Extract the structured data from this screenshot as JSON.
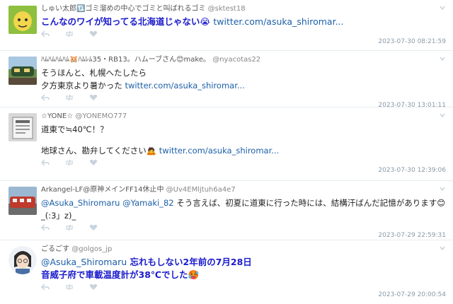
{
  "tweets": [
    {
      "name": "しゅい太郎🔃ゴミ溜めの中心でゴミと叫ばれるゴミ",
      "handle": "@sktest18",
      "lines": [
        "こんなのワイが知ってる北海道じゃない😭"
      ],
      "link": "twitter.com/asuka_shiromar...",
      "date": "2023-07-30 08:21:59"
    },
    {
      "name": "ﾊﾑﾊﾑﾊﾑﾊﾑ🐹ﾊﾑﾚﾑ35・RB13。ハムーブさん😊make。",
      "handle": "@nyacotas22",
      "lines": [
        "そうほんと、札幌へたしたら",
        "夕方東京より暑かった"
      ],
      "link": "twitter.com/asuka_shiromar...",
      "date": "2023-07-30 13:01:11"
    },
    {
      "name": "☆YONE☆",
      "handle": "@YONEMO777",
      "lines": [
        "道東で≒40℃！？",
        "",
        "地球さん、勘弁してください🙇"
      ],
      "link": "twitter.com/asuka_shiromar...",
      "date": "2023-07-30 12:39:06"
    },
    {
      "name": "Arkangel-LF@原神メインFF14休止中",
      "handle": "@Uv4EMljtuh6a4e7",
      "mention1": "@Asuka_Shiromaru",
      "mention2": "@Yamaki_82",
      "text": "そう言えば、初夏に道東に行った時には、結構汗ばんだ記憶があります😊",
      "text2": "_(:3」z)_",
      "date": "2023-07-29 22:59:31"
    },
    {
      "name": "ごるごす",
      "handle": "@golgos_jp",
      "mention1": "@Asuka_Shiromaru",
      "text": "忘れもしない2年前の7月28日",
      "text2": "音威子府で車載温度計が38℃でした🥵",
      "date": "2023-07-29 20:00:54"
    }
  ],
  "icons": {
    "reply": "reply-icon",
    "retweet": "retweet-icon",
    "like": "heart-icon",
    "menu": "chevron-down-icon"
  },
  "colors": {
    "link": "#1b5fa8",
    "emphasis_text": "#1a1acc",
    "meta": "#8899a6",
    "icon": "#c8d3dc"
  }
}
